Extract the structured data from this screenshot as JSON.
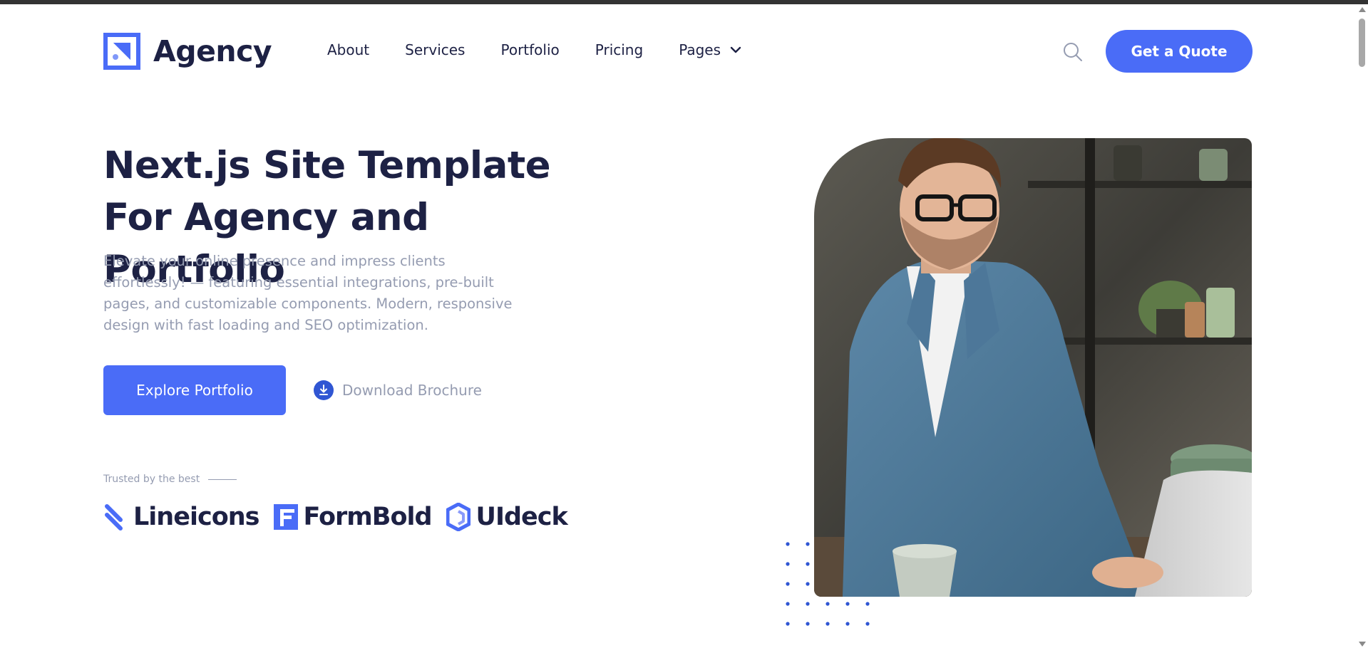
{
  "header": {
    "logo_text": "Agency",
    "nav": [
      {
        "label": "About"
      },
      {
        "label": "Services"
      },
      {
        "label": "Portfolio"
      },
      {
        "label": "Pricing"
      },
      {
        "label": "Pages",
        "has_dropdown": true
      }
    ],
    "search_icon": "search-icon",
    "cta_label": "Get a Quote"
  },
  "hero": {
    "title": "Next.js Site Template For Agency and Portfolio",
    "description": "Elevate your online presence and impress clients effortlessly! — featuring essential integrations, pre-built pages, and customizable components. Modern, responsive design with fast loading and SEO optimization.",
    "primary_button": "Explore Portfolio",
    "secondary_button": "Download Brochure",
    "trusted_text": "Trusted by the best",
    "brands": [
      {
        "name": "Lineicons",
        "icon": "lineicons-logo-icon"
      },
      {
        "name": "FormBold",
        "icon": "formbold-logo-icon"
      },
      {
        "name": "UIdeck",
        "icon": "uideck-logo-icon"
      }
    ],
    "image_alt": "man-with-glasses-working-on-laptop"
  },
  "colors": {
    "primary": "#4a6cf7",
    "heading": "#1d2144",
    "body_text": "#959cb1",
    "background": "#ffffff"
  }
}
